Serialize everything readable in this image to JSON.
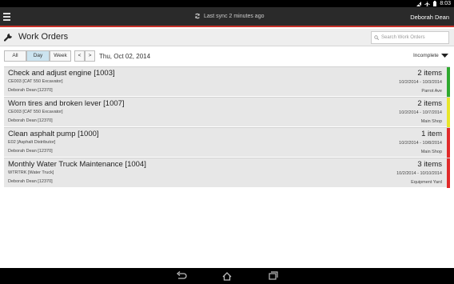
{
  "status_bar": {
    "time": "8:03"
  },
  "app_bar": {
    "sync_text": "Last sync 2 minutes ago",
    "user_name": "Deborah Dean"
  },
  "header": {
    "title": "Work Orders",
    "search_placeholder": "Search Work Orders"
  },
  "toolbar": {
    "views": [
      "All",
      "Day",
      "Week"
    ],
    "active_view": "Day",
    "prev": "<",
    "next": ">",
    "date": "Thu, Oct 02, 2014",
    "filter": "Incomplete"
  },
  "work_orders": [
    {
      "title": "Check and adjust engine [1003]",
      "equipment": "CE003 [CAT 550 Excavator]",
      "person": "Deborah Dean [12370]",
      "items": "2 items",
      "dates": "10/2/2014 - 10/3/2014",
      "location": "Parrot Ave",
      "status_color": "#2ea82e"
    },
    {
      "title": "Worn tires and broken lever [1007]",
      "equipment": "CE003 [CAT 550 Excavator]",
      "person": "Deborah Dean [12370]",
      "items": "2 items",
      "dates": "10/2/2014 - 10/7/2014",
      "location": "Main Shop",
      "status_color": "#e8e52a"
    },
    {
      "title": "Clean asphalt pump [1000]",
      "equipment": "E02 [Asphalt Distributor]",
      "person": "Deborah Dean [12370]",
      "items": "1 item",
      "dates": "10/2/2014 - 10/8/2014",
      "location": "Main Shop",
      "status_color": "#e02a2a"
    },
    {
      "title": "Monthly Water Truck Maintenance [1004]",
      "equipment": "WTRTRK [Water Truck]",
      "person": "Deborah Dean [12370]",
      "items": "3 items",
      "dates": "10/2/2014 - 10/10/2014",
      "location": "Equipment Yard",
      "status_color": "#e02a2a"
    }
  ]
}
